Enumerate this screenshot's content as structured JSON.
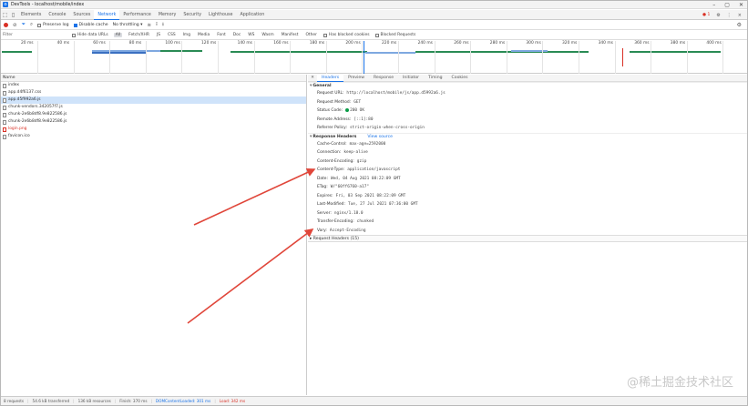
{
  "window": {
    "title": "DevTools - localhost/mobile/index"
  },
  "tabs": [
    "Elements",
    "Console",
    "Sources",
    "Network",
    "Performance",
    "Memory",
    "Security",
    "Lighthouse",
    "Application"
  ],
  "tabs_right": {
    "errors": "1",
    "close": "×"
  },
  "toolbar": {
    "preserve_log": "Preserve log",
    "disable_cache": "Disable cache",
    "throttling": "No throttling"
  },
  "filter": {
    "placeholder": "Filter",
    "hide_data_urls": "Hide data URLs",
    "types": [
      "All",
      "Fetch/XHR",
      "JS",
      "CSS",
      "Img",
      "Media",
      "Font",
      "Doc",
      "WS",
      "Wasm",
      "Manifest",
      "Other"
    ],
    "blocked_cookies": "Has blocked cookies",
    "blocked_requests": "Blocked Requests"
  },
  "timeline": {
    "ticks": [
      "20 ms",
      "40 ms",
      "60 ms",
      "80 ms",
      "100 ms",
      "120 ms",
      "140 ms",
      "160 ms",
      "180 ms",
      "200 ms",
      "220 ms",
      "240 ms",
      "260 ms",
      "280 ms",
      "300 ms",
      "320 ms",
      "340 ms",
      "360 ms",
      "380 ms",
      "400 ms"
    ]
  },
  "requests": {
    "header": "Name",
    "items": [
      "index",
      "app.d4f6137.css",
      "app.d5f992a6.js",
      "chunk-vendors.342057f7.js",
      "chunk-2e6b8df8.9e822586.js",
      "chunk-2e6b8df8.9e822586.js",
      "login.png",
      "favicon.ico"
    ]
  },
  "detail": {
    "tabs": [
      "Headers",
      "Preview",
      "Response",
      "Initiator",
      "Timing",
      "Cookies"
    ],
    "general": {
      "title": "General",
      "rows": [
        {
          "k": "Request URL:",
          "v": "http://localhost/mobile/js/app.d5992a6.js"
        },
        {
          "k": "Request Method:",
          "v": "GET"
        },
        {
          "k": "Status Code:",
          "v": "200 OK"
        },
        {
          "k": "Remote Address:",
          "v": "[::1]:80"
        },
        {
          "k": "Referrer Policy:",
          "v": "strict-origin-when-cross-origin"
        }
      ]
    },
    "response": {
      "title": "Response Headers",
      "view_source": "View source",
      "rows": [
        {
          "k": "Cache-Control:",
          "v": "max-age=2592000"
        },
        {
          "k": "Connection:",
          "v": "keep-alive"
        },
        {
          "k": "Content-Encoding:",
          "v": "gzip"
        },
        {
          "k": "Content-Type:",
          "v": "application/javascript"
        },
        {
          "k": "Date:",
          "v": "Wed, 04 Aug 2021 08:22:09 GMT"
        },
        {
          "k": "ETag:",
          "v": "W/\"60ff6760-a17\""
        },
        {
          "k": "Expires:",
          "v": "Fri, 03 Sep 2021 08:22:09 GMT"
        },
        {
          "k": "Last-Modified:",
          "v": "Tue, 27 Jul 2021 07:36:00 GMT"
        },
        {
          "k": "Server:",
          "v": "nginx/1.18.0"
        },
        {
          "k": "Transfer-Encoding:",
          "v": "chunked"
        },
        {
          "k": "Vary:",
          "v": "Accept-Encoding"
        }
      ]
    },
    "request_headers": "Request Headers (15)"
  },
  "statusbar": {
    "requests": "8 requests",
    "transferred": "54.6 kB transferred",
    "resources": "136 kB resources",
    "finish": "Finish: 370 ms",
    "dcl": "DOMContentLoaded: 301 ms",
    "load": "Load: 342 ms"
  },
  "watermark": "@稀土掘金技术社区",
  "colors": {
    "accent": "#1a73e8",
    "error": "#d93025",
    "arrow": "#e0463a"
  }
}
